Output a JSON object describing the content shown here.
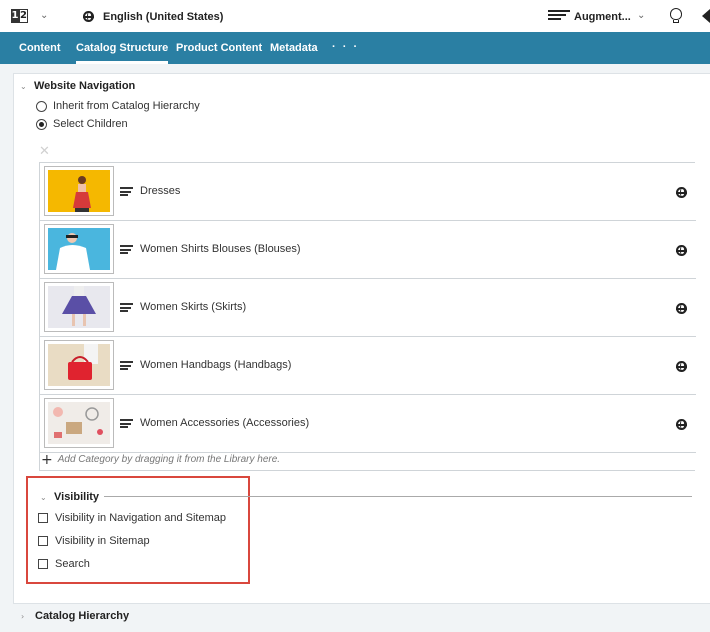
{
  "topbar": {
    "locale": "English (United States)",
    "augment_label": "Augment..."
  },
  "tabs": [
    "Content",
    "Catalog Structure",
    "Product Content",
    "Metadata"
  ],
  "tab_more": "· · ·",
  "website_navigation": {
    "title": "Website Navigation",
    "options": [
      "Inherit from Catalog Hierarchy",
      "Select Children"
    ],
    "selected": "Select Children",
    "categories": [
      {
        "label": "Dresses"
      },
      {
        "label": "Women Shirts Blouses (Blouses)"
      },
      {
        "label": "Women Skirts (Skirts)"
      },
      {
        "label": "Women Handbags (Handbags)"
      },
      {
        "label": "Women Accessories (Accessories)"
      }
    ],
    "add_hint": "Add Category by dragging it from the Library here."
  },
  "visibility": {
    "title": "Visibility",
    "checkboxes": [
      {
        "label": "Visibility in Navigation and Sitemap",
        "checked": false
      },
      {
        "label": "Visibility in Sitemap",
        "checked": false
      },
      {
        "label": "Search",
        "checked": false
      }
    ]
  },
  "catalog_hierarchy": {
    "title": "Catalog Hierarchy"
  },
  "colors": {
    "tab_bar": "#2a7fa3",
    "highlight": "#d9473d"
  }
}
